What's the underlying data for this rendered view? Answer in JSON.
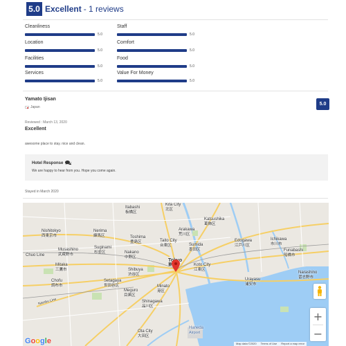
{
  "summary": {
    "score": "5.0",
    "label": "Excellent",
    "count": " - 1 reviews"
  },
  "ratings": [
    {
      "label": "Cleanliness",
      "value": "5.0",
      "fill": 1.0
    },
    {
      "label": "Location",
      "value": "5.0",
      "fill": 1.0
    },
    {
      "label": "Facilities",
      "value": "5.0",
      "fill": 1.0
    },
    {
      "label": "Services",
      "value": "5.0",
      "fill": 1.0
    },
    {
      "label": "Staff",
      "value": "5.0",
      "fill": 1.0
    },
    {
      "label": "Comfort",
      "value": "5.0",
      "fill": 1.0
    },
    {
      "label": "Food",
      "value": "5.0",
      "fill": 1.0
    },
    {
      "label": "Value For Money",
      "value": "5.0",
      "fill": 1.0
    }
  ],
  "review": {
    "reviewer": "Yamato Ijisan",
    "country": "Japan",
    "score": "5.0",
    "reviewed_date": "Reviewed : March 13, 2020",
    "title": "Excellent",
    "body": "awesome place to stay. nice and clean."
  },
  "hotel_response": {
    "title": "Hotel Response",
    "text": "We are happy to hear from you. Hope you come again."
  },
  "stayed": "Stayed in March 2020",
  "map": {
    "labels": {
      "itabashi": [
        "Itabashi",
        "板橋区"
      ],
      "kita": [
        "Kita City",
        "北区"
      ],
      "katsushika": [
        "Katsushika",
        "葛飾区"
      ],
      "nishitokyo": [
        "Nishitokyo",
        "西東京市"
      ],
      "nerima": [
        "Nerima",
        "練馬区"
      ],
      "toshima": [
        "Toshima",
        "豊島区"
      ],
      "arakawa": [
        "Arakawa",
        "荒川区"
      ],
      "taito": [
        "Taito City",
        "台東区"
      ],
      "sumida": [
        "Sumida",
        "墨田区"
      ],
      "edogawa": [
        "Edogawa",
        "江戸川区"
      ],
      "ichikawa": [
        "Ichikawa",
        "市川市"
      ],
      "musashino": [
        "Musashino",
        "武蔵野市"
      ],
      "suginami": [
        "Suginami",
        "杉並区"
      ],
      "nakano": [
        "Nakano",
        "中野区"
      ],
      "chuoline": [
        "Chuo Line",
        ""
      ],
      "mitaka": [
        "Mitaka",
        "三鷹市"
      ],
      "shibuya": [
        "Shibuya",
        "渋谷区"
      ],
      "tokyo": [
        "Tokyo",
        "東京"
      ],
      "koto": [
        "Koto City",
        "江東区"
      ],
      "funabashi": [
        "Funabashi",
        "船橋市"
      ],
      "urayasu": [
        "Urayasu",
        "浦安市"
      ],
      "chofu": [
        "Chofu",
        "調布市"
      ],
      "setagaya": [
        "Setagaya",
        "世田谷区"
      ],
      "narashino": [
        "Narashino",
        "習志野市"
      ],
      "minato": [
        "Minato",
        "港区"
      ],
      "shinagawa": [
        "Shinagawa",
        "品川区"
      ],
      "meguro": [
        "Meguro",
        "目黒区"
      ],
      "ota": [
        "Ota City",
        "大田区"
      ],
      "haneda": [
        "Haneda",
        "Airport"
      ],
      "nagawa": [
        "Nambu Line",
        ""
      ]
    },
    "google_logo": "Google",
    "attribution": [
      "Map data ©2020",
      "Terms of Use",
      "Report a map error"
    ],
    "zoom_in": "+",
    "zoom_out": "−"
  },
  "colors": {
    "accent": "#1f3c88",
    "response_bg": "#f2f2f2",
    "map_water": "#9ecdf5",
    "map_land": "#ebe8e2",
    "map_park": "#c9e2b3",
    "pin": "#e0342b"
  }
}
